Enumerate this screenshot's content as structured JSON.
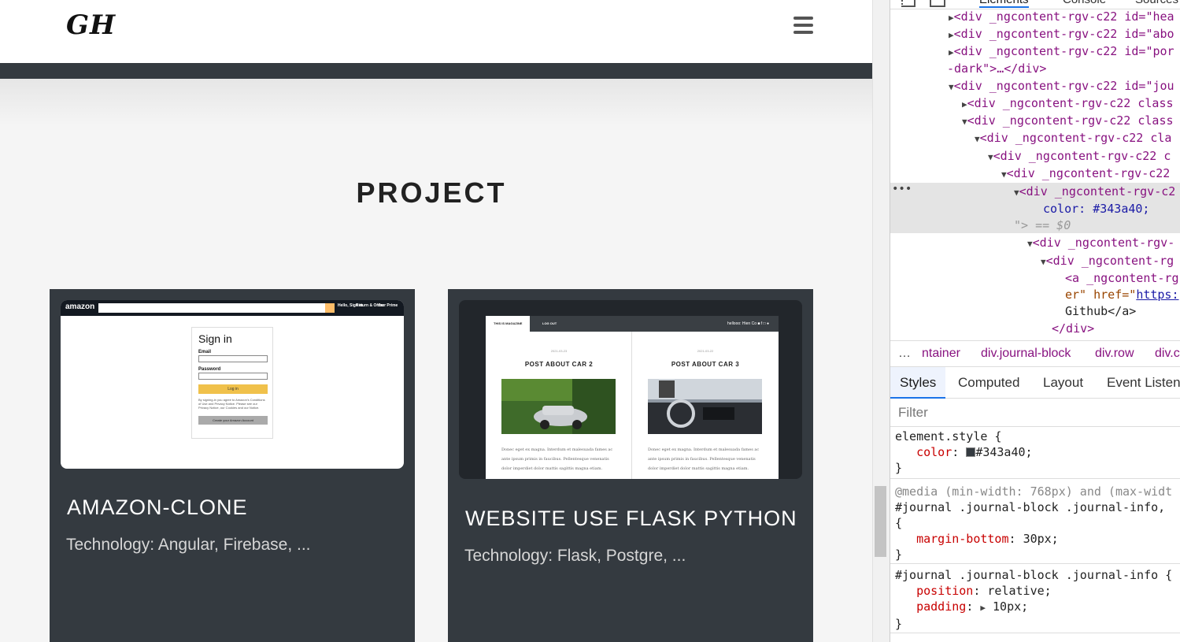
{
  "site": {
    "logo": "GH",
    "section_title": "PROJECT",
    "projects": [
      {
        "title": "AMAZON-CLONE",
        "desc": "Technology: Angular, Firebase, ...",
        "preview": {
          "logo": "amazon",
          "nav": [
            "Hello, Sign in",
            "Return & Order",
            "Your Prime"
          ],
          "heading": "Sign in",
          "email_label": "Email",
          "password_label": "Password",
          "login_button": "Log in",
          "fine_print": "By signing-in you agree to Amazon's Conditions of Use and Privacy Notice. Please see our Privacy Notice, our Cookies and our Notice.",
          "create_button": "Create your Amazon Account"
        }
      },
      {
        "title": "WEBSITE USE FLASK PYTHON",
        "desc": "Technology: Flask, Postgre, ...",
        "preview": {
          "tab_active": "THIS IS MAGAZINE",
          "tab_logout": "LOG OUT",
          "greeting": "hellooo: Hien Co",
          "posts": [
            {
              "date": "2021-03-23",
              "title": "POST ABOUT CAR 2",
              "text": "Donec eget ex magna. Interdum et malesuada fames ac ante ipsum primis in faucibus. Pellentesque venenatis dolor imperdiet dolor mattis sagittis magna etiam."
            },
            {
              "date": "2021-03-22",
              "title": "POST ABOUT CAR 3",
              "text": "Donec eget ex magna. Interdum et malesuada fames ac ante ipsum primis in faucibus. Pellentesque venenatis dolor imperdiet dolor mattis sagittis magna etiam."
            }
          ]
        }
      }
    ]
  },
  "devtools": {
    "tabs": [
      "Elements",
      "Console",
      "Sources"
    ],
    "dom_lines": {
      "l1": "<div _ngcontent-rgv-c22 id=\"hea",
      "l2": "<div _ngcontent-rgv-c22 id=\"abo",
      "l3": "<div _ngcontent-rgv-c22 id=\"por",
      "l4": "-dark\">…</div>",
      "l5": "<div _ngcontent-rgv-c22 id=\"jou",
      "l6": "<div _ngcontent-rgv-c22 class",
      "l7": "<div _ngcontent-rgv-c22 class",
      "l8": "<div _ngcontent-rgv-c22 cla",
      "l9": "<div _ngcontent-rgv-c22 c",
      "l10": "<div _ngcontent-rgv-c22",
      "l11": "<div _ngcontent-rgv-c2",
      "l12": "color: #343a40;",
      "l13": "\"> == $0",
      "l14": "<div _ngcontent-rgv-",
      "l15": "<div _ngcontent-rg",
      "l16": "<a _ngcontent-rg",
      "l17a": "er\" href=\"",
      "l17b": "https:",
      "l18": "Github</a>",
      "l19": "</div>"
    },
    "breadcrumbs": [
      "…",
      "ntainer",
      "div.journal-block",
      "div.row",
      "div.c"
    ],
    "style_tabs": [
      "Styles",
      "Computed",
      "Layout",
      "Event Listen"
    ],
    "filter_placeholder": "Filter",
    "rules": {
      "r1_sel": "element.style {",
      "r1_prop": "color",
      "r1_val": "#343a40;",
      "r2_media": "@media (min-width: 768px) and (max-widt",
      "r2_sel": "#journal .journal-block .journal-info,",
      "r2_prop": "margin-bottom",
      "r2_val": "30px;",
      "r3_sel": "#journal .journal-block .journal-info {",
      "r3_prop1": "position",
      "r3_val1": "relative;",
      "r3_prop2": "padding",
      "r3_val2": "10px;"
    }
  }
}
